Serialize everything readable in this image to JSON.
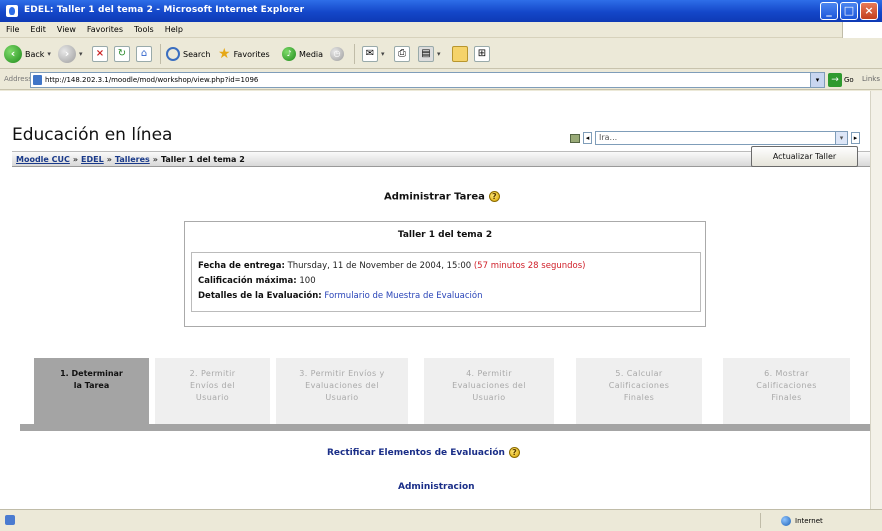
{
  "window": {
    "title": "EDEL: Taller 1 del tema 2 - Microsoft Internet Explorer"
  },
  "menu": [
    "File",
    "Edit",
    "View",
    "Favorites",
    "Tools",
    "Help"
  ],
  "toolbar": {
    "back": "Back",
    "search": "Search",
    "favorites": "Favorites",
    "media": "Media"
  },
  "address": {
    "label": "Address",
    "url": "http://148.202.3.1/moodle/mod/workshop/view.php?id=1096",
    "go": "Go",
    "links": "Links"
  },
  "site": {
    "title": "Educación en línea",
    "jump_value": "Ira..."
  },
  "breadcrumb": {
    "items": [
      "Moodle CUC",
      "EDEL",
      "Talleres"
    ],
    "separator": "»",
    "current": "Taller 1 del tema 2"
  },
  "update_button": "Actualizar Taller",
  "admin_heading": "Administrar Tarea",
  "task": {
    "title": "Taller 1 del tema 2",
    "due_label": "Fecha de entrega:",
    "due_value": "Thursday, 11 de November de 2004, 15:00",
    "due_remaining": "(57 minutos 28 segundos)",
    "max_grade_label": "Calificación máxima:",
    "max_grade_value": "100",
    "eval_label": "Detalles de la Evaluación:",
    "eval_link": "Formulario de Muestra de Evaluación"
  },
  "steps": [
    {
      "line1": "1. Determinar",
      "line2": "la Tarea",
      "line3": ""
    },
    {
      "line1": "2. Permitir",
      "line2": "Envíos del",
      "line3": "Usuario"
    },
    {
      "line1": "3. Permitir Envíos y",
      "line2": "Evaluaciones del",
      "line3": "Usuario"
    },
    {
      "line1": "4. Permitir",
      "line2": "Evaluaciones del",
      "line3": "Usuario"
    },
    {
      "line1": "5. Calcular",
      "line2": "Calificaciones",
      "line3": "Finales"
    },
    {
      "line1": "6. Mostrar",
      "line2": "Calificaciones",
      "line3": "Finales"
    }
  ],
  "links": {
    "rectify": "Rectificar Elementos de Evaluación",
    "admin": "Administracion"
  },
  "status": {
    "zone": "Internet"
  },
  "colors": {
    "link": "#1A2E88",
    "active_step": "#A4A4A4",
    "remaining_red": "#D0202A"
  }
}
